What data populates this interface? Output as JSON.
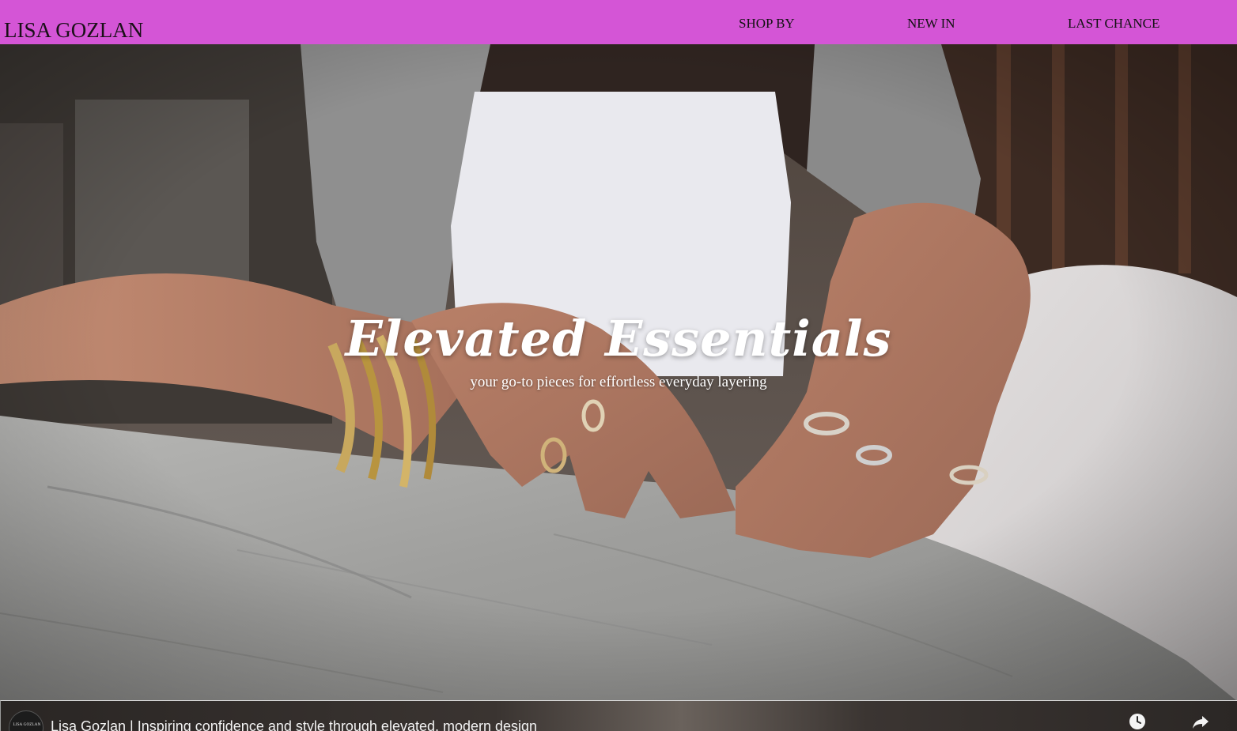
{
  "header": {
    "logo": "LISA GOZLAN",
    "nav": [
      {
        "label": "SHOP BY"
      },
      {
        "label": "NEW IN"
      },
      {
        "label": "LAST CHANCE"
      }
    ],
    "background_color": "#d455d6"
  },
  "hero": {
    "title": "Elevated Essentials",
    "subtitle": "your go-to pieces for effortless everyday layering"
  },
  "video": {
    "channel_avatar_text": "LISA GOZLAN",
    "title": "Lisa Gozlan | Inspiring confidence and style through elevated, modern design",
    "icons": [
      "clock-icon",
      "share-icon"
    ]
  }
}
